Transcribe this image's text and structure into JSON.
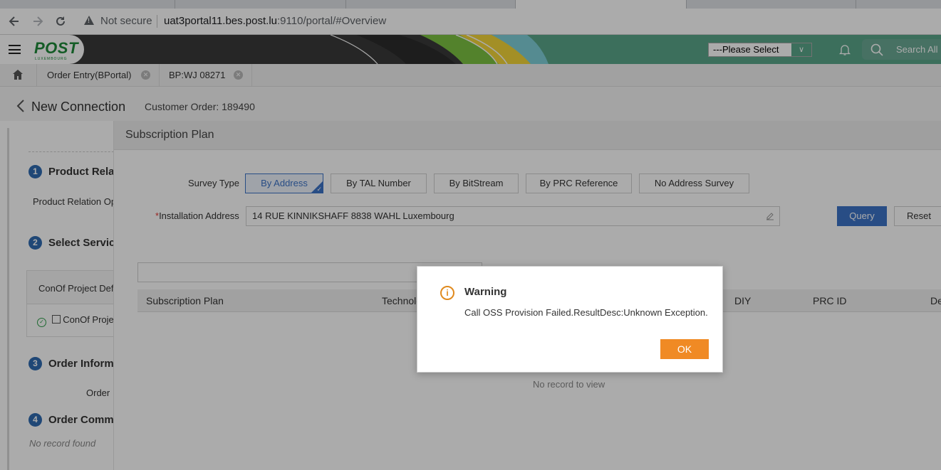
{
  "browser": {
    "security_label": "Not secure",
    "url_host": "uat3portal11.bes.post.lu",
    "url_rest": ":9110/portal/#Overview"
  },
  "header": {
    "logo_text": "POST",
    "logo_subtext": "LUXEMBOURG",
    "select_value": "---Please Select",
    "search_label": "Search All"
  },
  "tabs": [
    {
      "label": "Order Entry(BPortal)"
    },
    {
      "label": "BP:WJ 08271"
    }
  ],
  "page": {
    "title": "New Connection",
    "customer_order": "Customer Order: 189490"
  },
  "left_panel": {
    "steps": [
      {
        "num": "1",
        "label": "Product Relation"
      },
      {
        "num": "2",
        "label": "Select Service"
      },
      {
        "num": "3",
        "label": "Order Information"
      },
      {
        "num": "4",
        "label": "Order Comments"
      }
    ],
    "product_relation_text": "Product Relation Option",
    "conof_header": "ConOf Project Definition",
    "conof_row": "ConOf Project",
    "order_label": "Order",
    "no_record": "No record found"
  },
  "main": {
    "section_title": "Subscription Plan",
    "survey_type_label": "Survey Type",
    "survey_buttons": [
      "By Address",
      "By TAL Number",
      "By BitStream",
      "By PRC Reference",
      "No Address Survey"
    ],
    "installation_label": "Installation Address",
    "installation_value": "14 RUE KINNIKSHAFF 8838 WAHL Luxembourg",
    "query_label": "Query",
    "reset_label": "Reset",
    "columns": [
      "Subscription Plan",
      "Technology",
      "DIY",
      "PRC ID",
      "Delivery"
    ],
    "no_record": "No record to view"
  },
  "dialog": {
    "title": "Warning",
    "message": "Call OSS Provision Failed.ResultDesc:Unknown Exception.",
    "ok_label": "OK"
  },
  "colors": {
    "accent_blue": "#3c73c7",
    "brand_green": "#1e8a3a",
    "warning_orange": "#f08a24"
  }
}
